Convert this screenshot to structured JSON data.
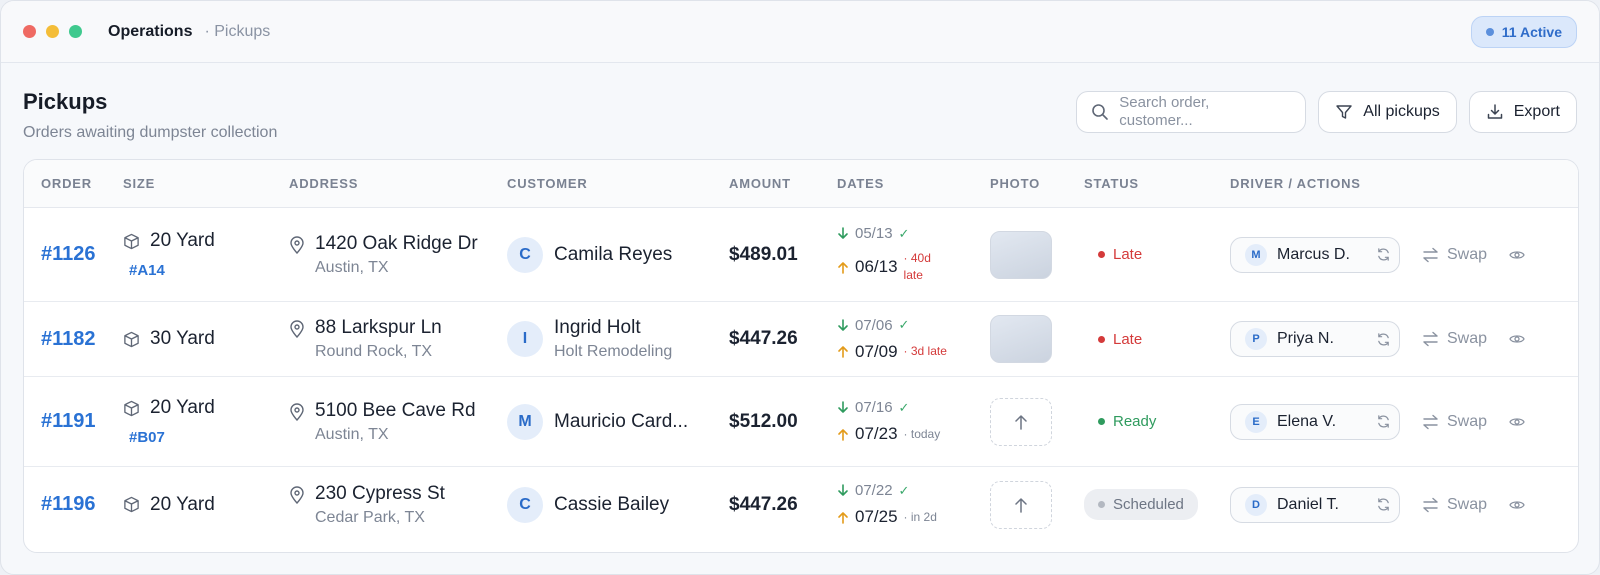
{
  "titlebar": {
    "section": "Operations",
    "page": "· Pickups",
    "active_badge": "11 Active"
  },
  "header": {
    "title": "Pickups",
    "subtitle": "Orders awaiting dumpster collection"
  },
  "toolbar": {
    "search_placeholder": "Search order, customer...",
    "filter_label": "All pickups",
    "export_label": "Export"
  },
  "table": {
    "columns": [
      "ORDER",
      "SIZE",
      "ADDRESS",
      "CUSTOMER",
      "AMOUNT",
      "DATES",
      "PHOTO",
      "STATUS",
      "DRIVER / ACTIONS"
    ],
    "rows": [
      {
        "order": "#1126",
        "size": "20 Yard",
        "size_tag": "#A14",
        "address": "1420 Oak Ridge Dr",
        "city": "Austin, TX",
        "customer_initial": "C",
        "customer": "Camila Reyes",
        "customer_sub": "",
        "amount": "$489.01",
        "date_drop": "05/13",
        "date_pick": "06/13",
        "date_note_1": "· 40d",
        "date_note_2": "late",
        "photo": "thumbnail",
        "status": "Late",
        "driver_initial": "M",
        "driver": "Marcus D.",
        "swap": "Swap"
      },
      {
        "order": "#1182",
        "size": "30 Yard",
        "size_tag": "",
        "address": "88 Larkspur Ln",
        "city": "Round Rock, TX",
        "customer_initial": "I",
        "customer": "Ingrid Holt",
        "customer_sub": "Holt Remodeling",
        "amount": "$447.26",
        "date_drop": "07/06",
        "date_pick": "07/09",
        "date_note_1": "· 3d late",
        "date_note_2": "",
        "photo": "thumbnail",
        "status": "Late",
        "driver_initial": "P",
        "driver": "Priya N.",
        "swap": "Swap"
      },
      {
        "order": "#1191",
        "size": "20 Yard",
        "size_tag": "#B07",
        "address": "5100 Bee Cave Rd",
        "city": "Austin, TX",
        "customer_initial": "M",
        "customer": "Mauricio Card...",
        "customer_sub": "",
        "amount": "$512.00",
        "date_drop": "07/16",
        "date_pick": "07/23",
        "date_note_1": "· today",
        "date_note_2": "",
        "photo": "upload",
        "status": "Ready",
        "driver_initial": "E",
        "driver": "Elena V.",
        "swap": "Swap"
      },
      {
        "order": "#1196",
        "size": "20 Yard",
        "size_tag": "",
        "address": "230 Cypress St",
        "city": "Cedar Park, TX",
        "customer_initial": "C",
        "customer": "Cassie Bailey",
        "customer_sub": "",
        "amount": "$447.26",
        "date_drop": "07/22",
        "date_pick": "07/25",
        "date_note_1": "· in 2d",
        "date_note_2": "",
        "photo": "upload",
        "status": "Scheduled",
        "driver_initial": "D",
        "driver": "Daniel T.",
        "swap": "Swap"
      }
    ]
  }
}
